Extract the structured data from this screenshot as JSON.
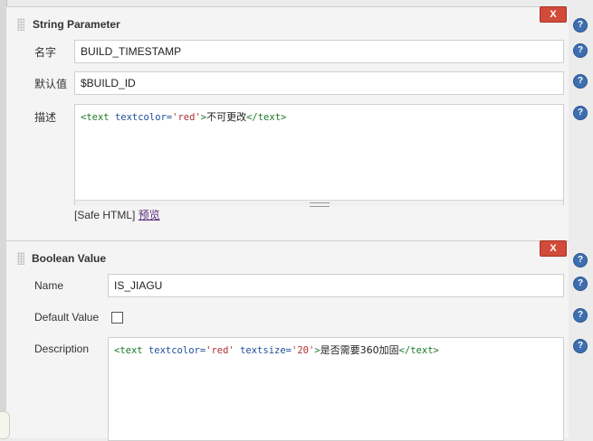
{
  "string_param": {
    "title": "String Parameter",
    "delete_label": "X",
    "name_label": "名字",
    "name_value": "BUILD_TIMESTAMP",
    "default_label": "默认值",
    "default_value": "$BUILD_ID",
    "desc_label": "描述",
    "desc_code": {
      "open_tag": "<text",
      "attr": "textcolor=",
      "attr_val": "'red'",
      "close_open": ">",
      "text": "不可更改",
      "end_tag": "</text>"
    },
    "safe_html": "[Safe HTML]",
    "preview": "预览"
  },
  "boolean_param": {
    "title": "Boolean Value",
    "delete_label": "X",
    "name_label": "Name",
    "name_value": "IS_JIAGU",
    "default_label": "Default Value",
    "default_checked": false,
    "desc_label": "Description",
    "desc_code": {
      "open_tag": "<text",
      "attr1": "textcolor=",
      "attr1_val": "'red'",
      "attr2": "textsize=",
      "attr2_val": "'20'",
      "close_open": ">",
      "text": "是否需要360加固",
      "end_tag": "</text>"
    }
  },
  "help_icon_label": "?",
  "colors": {
    "delete_button": "#d24a3a",
    "help_icon": "#3d6fb0",
    "tag_green": "#1b7a2a",
    "attr_blue": "#1f4e9c",
    "value_red": "#b03030",
    "link_purple": "#5a2a7a"
  }
}
